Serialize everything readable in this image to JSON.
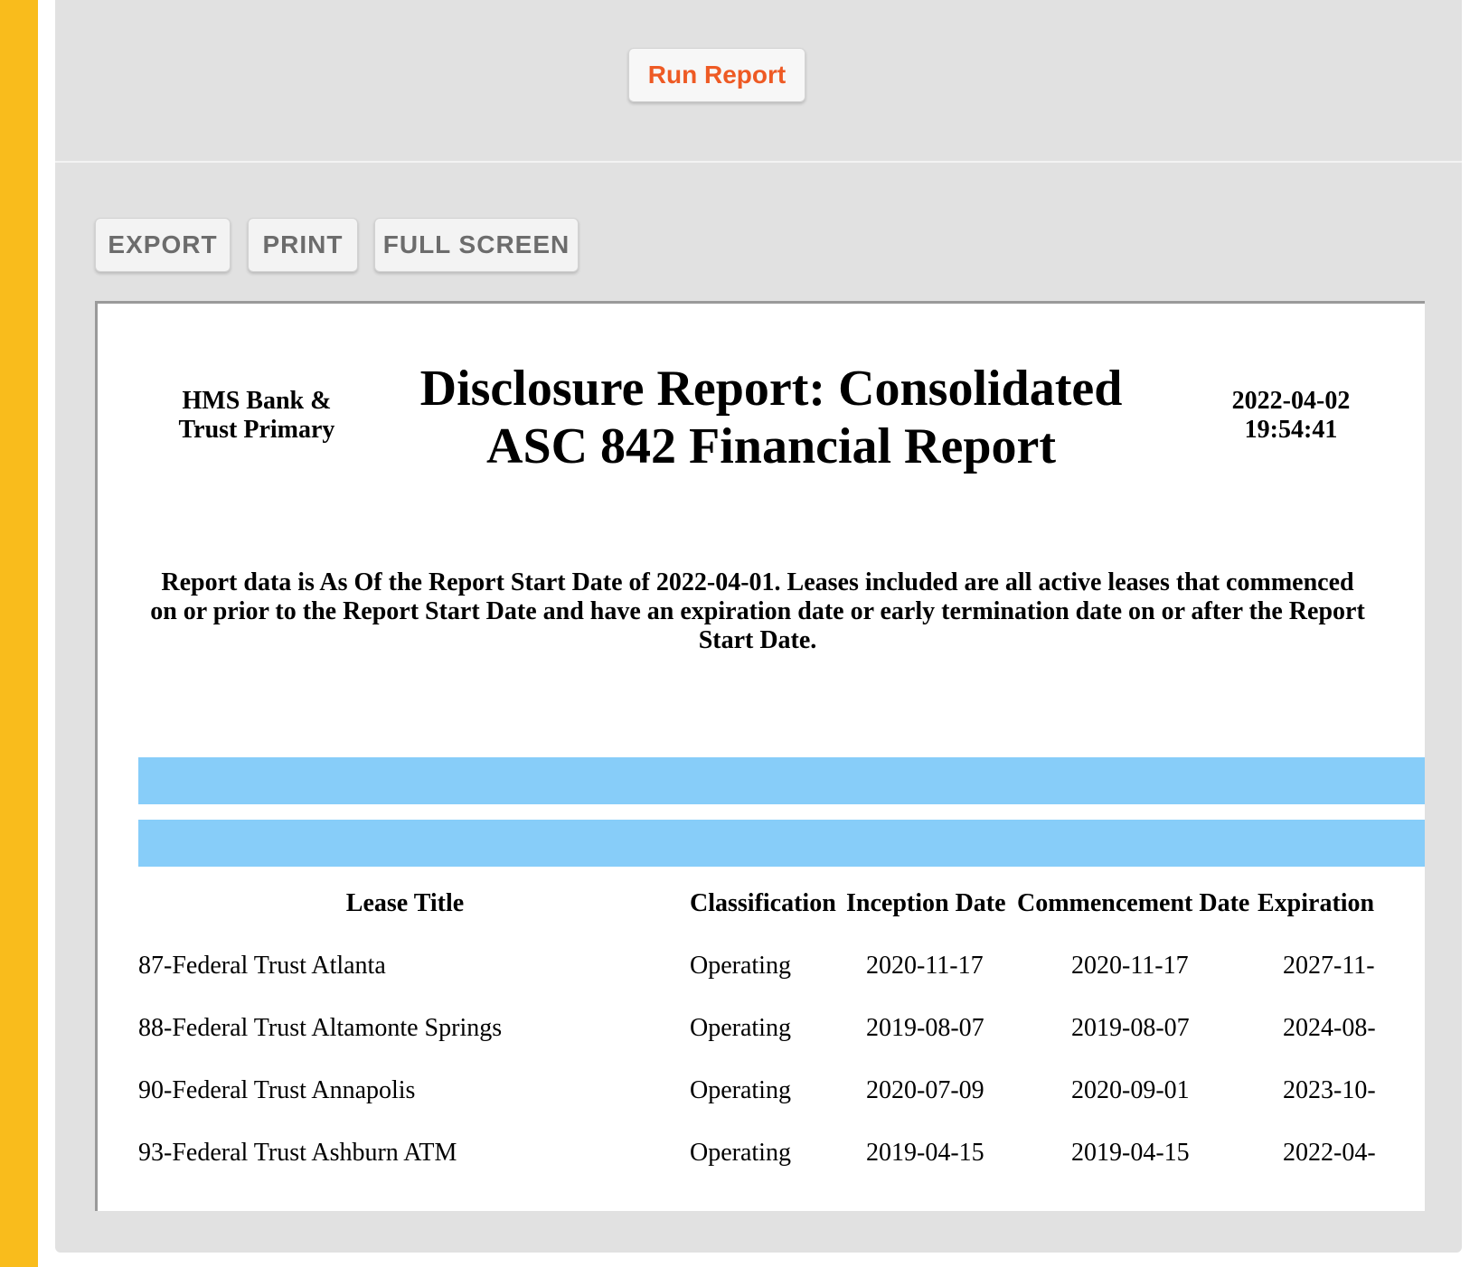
{
  "toolbar": {
    "run_report": "Run Report",
    "export": "EXPORT",
    "print": "PRINT",
    "full_screen": "FULL SCREEN"
  },
  "report": {
    "company_line1": "HMS Bank &",
    "company_line2": "Trust Primary",
    "title_line1": "Disclosure Report: Consolidated",
    "title_line2": "ASC 842 Financial Report",
    "date": "2022-04-02",
    "time": "19:54:41",
    "note": "Report data is As Of the Report Start Date of 2022-04-01. Leases included are all active leases that commenced on or prior to the Report Start Date and have an expiration date or early termination date on or after the Report Start Date.",
    "columns": [
      "Lease Title",
      "Classification",
      "Inception Date",
      "Commencement Date",
      "Expiration"
    ],
    "rows": [
      [
        "87-Federal Trust Atlanta",
        "Operating",
        "2020-11-17",
        "2020-11-17",
        "2027-11-"
      ],
      [
        "88-Federal Trust Altamonte Springs",
        "Operating",
        "2019-08-07",
        "2019-08-07",
        "2024-08-"
      ],
      [
        "90-Federal Trust Annapolis",
        "Operating",
        "2020-07-09",
        "2020-09-01",
        "2023-10-"
      ],
      [
        "93-Federal Trust Ashburn ATM",
        "Operating",
        "2019-04-15",
        "2019-04-15",
        "2022-04-"
      ]
    ]
  },
  "colors": {
    "accent": "#f9bc1c",
    "run_button_text": "#ee5a24",
    "header_band": "#87cdf9"
  }
}
